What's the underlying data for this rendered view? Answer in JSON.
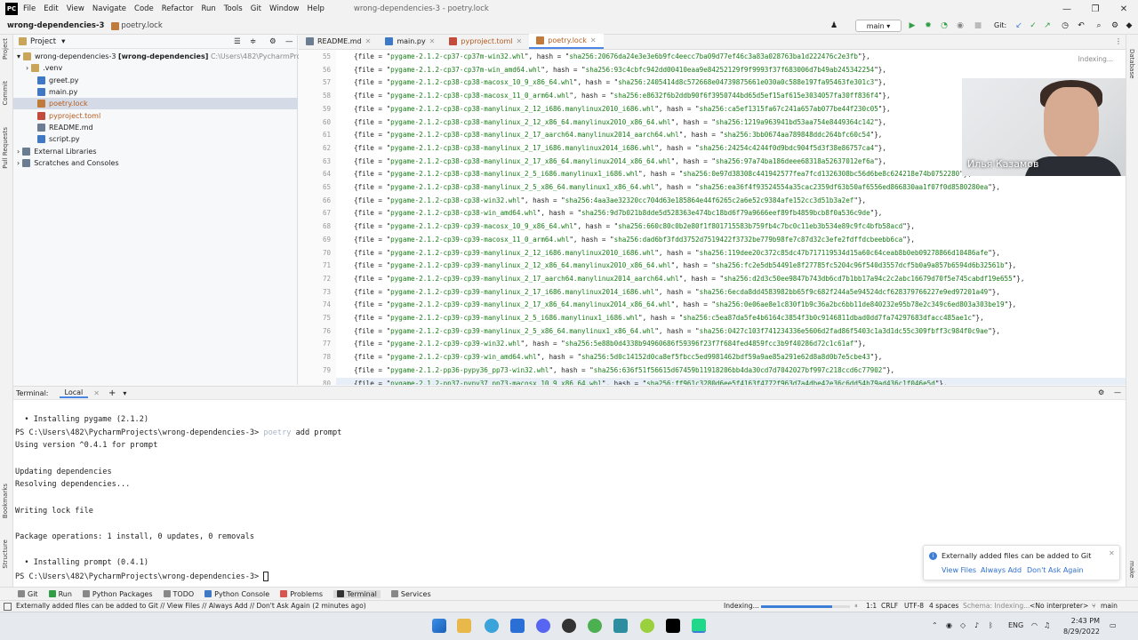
{
  "menubar": {
    "logo": "PC",
    "items": [
      "File",
      "Edit",
      "View",
      "Navigate",
      "Code",
      "Refactor",
      "Run",
      "Tools",
      "Git",
      "Window",
      "Help"
    ],
    "title": "wrong-dependencies-3 - poetry.lock",
    "minimize": "—",
    "restore": "❐",
    "close": "✕"
  },
  "navbar": {
    "project": "wrong-dependencies-3",
    "file": "poetry.lock",
    "branch": "main",
    "git_label": "Git:"
  },
  "left_stripe": [
    "Project",
    "Commit",
    "Pull Requests",
    "Bookmarks",
    "Structure"
  ],
  "right_stripe": [
    "Database",
    "make"
  ],
  "project_panel": {
    "title": "Project",
    "root": "wrong-dependencies-3",
    "root_bracket": "[wrong-dependencies]",
    "root_path": "C:\\Users\\482\\PycharmProjects\\wro",
    "items": [
      {
        "label": ".venv",
        "type": "folder"
      },
      {
        "label": "greet.py",
        "type": "py"
      },
      {
        "label": "main.py",
        "type": "py"
      },
      {
        "label": "poetry.lock",
        "type": "lock"
      },
      {
        "label": "pyproject.toml",
        "type": "toml"
      },
      {
        "label": "README.md",
        "type": "md"
      },
      {
        "label": "script.py",
        "type": "py"
      }
    ],
    "external": "External Libraries",
    "scratches": "Scratches and Consoles"
  },
  "tabs": [
    "README.md",
    "main.py",
    "pyproject.toml",
    "poetry.lock"
  ],
  "editor": {
    "indexing": "Indexing...",
    "lines": [
      {
        "n": "55",
        "file": "pygame-2.1.2-cp37-cp37m-win32.whl",
        "hash": "sha256:20676da24e3e3e6b9fc4eecc7ba09d77ef46c3a83a028763ba1d222476c2e3fb"
      },
      {
        "n": "56",
        "file": "pygame-2.1.2-cp37-cp37m-win_amd64.whl",
        "hash": "sha256:93c4cbfc942dd00410eaa9e84252129f9f9993f37f683006d7b49ab245342254"
      },
      {
        "n": "57",
        "file": "pygame-2.1.2-cp38-cp38-macosx_10_9_x86_64.whl",
        "hash": "sha256:2405414d8c572668e04739875661e030a0c588e197fa95463fe301c3"
      },
      {
        "n": "58",
        "file": "pygame-2.1.2-cp38-cp38-macosx_11_0_arm64.whl",
        "hash": "sha256:e8632f6b2ddb90f6f3950744bd65d5ef15af615e3034057fa30ff836f4"
      },
      {
        "n": "59",
        "file": "pygame-2.1.2-cp38-cp38-manylinux_2_12_i686.manylinux2010_i686.whl",
        "hash": "sha256:ca5ef1315fa67c241a657ab077be44f230c05"
      },
      {
        "n": "60",
        "file": "pygame-2.1.2-cp38-cp38-manylinux_2_12_x86_64.manylinux2010_x86_64.whl",
        "hash": "sha256:1219a963941bd53aa754e8449364c142"
      },
      {
        "n": "61",
        "file": "pygame-2.1.2-cp38-cp38-manylinux_2_17_aarch64.manylinux2014_aarch64.whl",
        "hash": "sha256:3bb0674aa789848ddc264bfc60c54"
      },
      {
        "n": "62",
        "file": "pygame-2.1.2-cp38-cp38-manylinux_2_17_i686.manylinux2014_i686.whl",
        "hash": "sha256:24254c4244f0d9bdc904f5d3f38e86757ca4"
      },
      {
        "n": "63",
        "file": "pygame-2.1.2-cp38-cp38-manylinux_2_17_x86_64.manylinux2014_x86_64.whl",
        "hash": "sha256:97a74ba186deee68318a52637012ef6a"
      },
      {
        "n": "64",
        "file": "pygame-2.1.2-cp38-cp38-manylinux_2_5_i686.manylinux1_i686.whl",
        "hash": "sha256:0e97d38308c441942577fea7fcd1326308bc56d6be8c624218e74b0752280"
      },
      {
        "n": "65",
        "file": "pygame-2.1.2-cp38-cp38-manylinux_2_5_x86_64.manylinux1_x86_64.whl",
        "hash": "sha256:ea36f4f93524554a35cac2359df63b50af6556ed866830aa1f07f0d8580280ea"
      },
      {
        "n": "66",
        "file": "pygame-2.1.2-cp38-cp38-win32.whl",
        "hash": "sha256:4aa3ae32320cc704d63e185864e44f6265c2a6e52c9384afe152cc3d51b3a2ef"
      },
      {
        "n": "67",
        "file": "pygame-2.1.2-cp38-cp38-win_amd64.whl",
        "hash": "sha256:9d7b021b8dde5d528363e474bc18bd6f79a9666eef89fb4859bcb8f0a536c9de"
      },
      {
        "n": "68",
        "file": "pygame-2.1.2-cp39-cp39-macosx_10_9_x86_64.whl",
        "hash": "sha256:660c80c0b2e80f1f801715583b759fb4c7bc0c11eb3b534e89c9fc4bfb58acd"
      },
      {
        "n": "69",
        "file": "pygame-2.1.2-cp39-cp39-macosx_11_0_arm64.whl",
        "hash": "sha256:dad6bf3fdd3752d7519422f3732be779b98fe7c87d32c3efe2fdffdcbeebb6ca"
      },
      {
        "n": "70",
        "file": "pygame-2.1.2-cp39-cp39-manylinux_2_12_i686.manylinux2010_i686.whl",
        "hash": "sha256:119dee20c372c85dc47b717119534d15a60c64ceab8b0eb09278866d10486afe"
      },
      {
        "n": "71",
        "file": "pygame-2.1.2-cp39-cp39-manylinux_2_12_x86_64.manylinux2010_x86_64.whl",
        "hash": "sha256:fc2e5db54491e8f27785fc5204c96f540d3557dcf5b0a9a857b6594d6b32561b"
      },
      {
        "n": "72",
        "file": "pygame-2.1.2-cp39-cp39-manylinux_2_17_aarch64.manylinux2014_aarch64.whl",
        "hash": "sha256:d2d3c50ee9847b743db6cd7b1bb17a94c2c2abc16679d70f5e745cabdf19e655"
      },
      {
        "n": "73",
        "file": "pygame-2.1.2-cp39-cp39-manylinux_2_17_i686.manylinux2014_i686.whl",
        "hash": "sha256:6ecda8dd4583982bb65f9c682f244a5e94524dcf628379766227e9ed97201a49"
      },
      {
        "n": "74",
        "file": "pygame-2.1.2-cp39-cp39-manylinux_2_17_x86_64.manylinux2014_x86_64.whl",
        "hash": "sha256:0e06ae8e1c830f1b9c36a2bc6bb11de840232e95b78e2c349c6ed803a303be19"
      },
      {
        "n": "75",
        "file": "pygame-2.1.2-cp39-cp39-manylinux_2_5_i686.manylinux1_i686.whl",
        "hash": "sha256:c5ea87da5fe4b6164c3854f3b0c9146811dbad0dd7fa74297683dfacc485ae1c"
      },
      {
        "n": "76",
        "file": "pygame-2.1.2-cp39-cp39-manylinux_2_5_x86_64.manylinux1_x86_64.whl",
        "hash": "sha256:0427c103f741234336e5606d2fad86f5403c1a3d1dc55c309fbff3c984f0c9ae"
      },
      {
        "n": "77",
        "file": "pygame-2.1.2-cp39-cp39-win32.whl",
        "hash": "sha256:5e88b0d4338b94960686f59396f23f7f684fed4859fcc3b9f40286d72c1c61af"
      },
      {
        "n": "78",
        "file": "pygame-2.1.2-cp39-cp39-win_amd64.whl",
        "hash": "sha256:5d0c14152d0ca8ef5fbcc5ed9981462bdf59a9ae85a291e62d8a8d0b7e5cbe43"
      },
      {
        "n": "79",
        "file": "pygame-2.1.2-pp36-pypy36_pp73-win32.whl",
        "hash": "sha256:636f51f56615d67459b11918206bb4da30cd7d7042027bf997c218ccd6c77902"
      },
      {
        "n": "80",
        "file": "pygame-2.1.2-pp37-pypy37_pp73-macosx_10_9_x86_64.whl",
        "hash": "sha256:ff961c3280d6ee5f4163f4772f963d7a4dbe42e36c6dd54b79ad436c1f046e5d"
      }
    ]
  },
  "webcam": {
    "name": "Илья Казамов"
  },
  "terminal": {
    "title": "Terminal:",
    "tab": "Local",
    "add": "+",
    "lines": [
      "  • Installing pygame (2.1.2)",
      "PS C:\\Users\\482\\PycharmProjects\\wrong-dependencies-3> ",
      "Using version ^0.4.1 for prompt",
      "",
      "Updating dependencies",
      "Resolving dependencies...",
      "",
      "Writing lock file",
      "",
      "Package operations: 1 install, 0 updates, 0 removals",
      "",
      "  • Installing prompt (0.4.1)",
      "PS C:\\Users\\482\\PycharmProjects\\wrong-dependencies-3> "
    ],
    "cmd_poetry": "poetry",
    "cmd_rest": " add prompt"
  },
  "notification": {
    "message": "Externally added files can be added to Git",
    "actions": [
      "View Files",
      "Always Add",
      "Don't Ask Again"
    ]
  },
  "toolwindows": [
    "Git",
    "Run",
    "Python Packages",
    "TODO",
    "Python Console",
    "Problems",
    "Terminal",
    "Services"
  ],
  "statusbar": {
    "message": "Externally added files can be added to Git // View Files // Always Add // Don't Ask Again (2 minutes ago)",
    "indexing": "Indexing...",
    "progress": 0.8,
    "position": "1:1",
    "line_sep": "CRLF",
    "encoding": "UTF-8",
    "indent": "4 spaces",
    "schema": "Schema: Indexing...",
    "interpreter": "<No interpreter>",
    "branch": "main"
  },
  "taskbar": {
    "lang": "ENG",
    "time": "2:43 PM",
    "date": "8/29/2022"
  },
  "colors": {
    "accent": "#3d7ed6",
    "string": "#177d17",
    "active_tab": "#4a87e4"
  }
}
